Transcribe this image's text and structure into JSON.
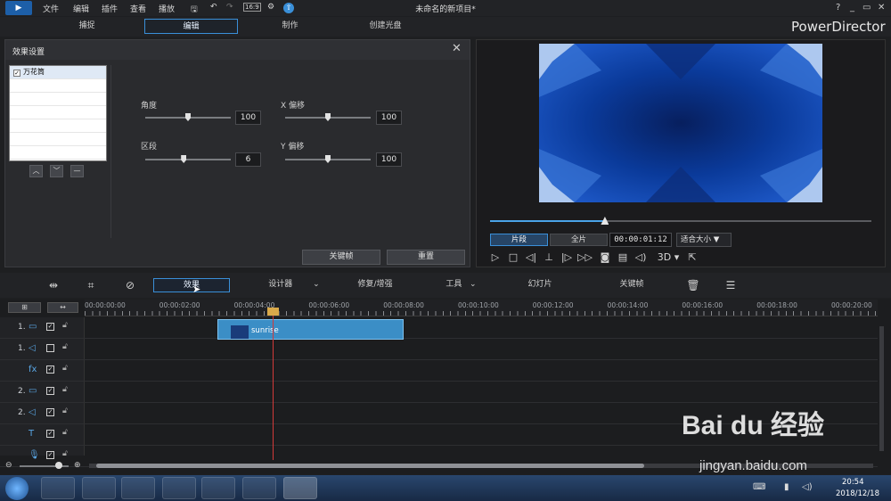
{
  "menu": {
    "items": [
      "文件",
      "编辑",
      "插件",
      "查看",
      "播放"
    ],
    "doc_title": "未命名的新项目*"
  },
  "window_controls": {
    "help": "?",
    "minimize": "_",
    "restore": "▭",
    "close": "✕"
  },
  "modes": [
    {
      "label": "捕捉"
    },
    {
      "label": "编辑",
      "active": true
    },
    {
      "label": "制作"
    },
    {
      "label": "创建光盘"
    }
  ],
  "brand": "PowerDirector",
  "effect_panel": {
    "title": "效果设置",
    "list": [
      {
        "label": "万花筒",
        "checked": true
      }
    ],
    "params": {
      "angle": {
        "label": "角度",
        "value": "100",
        "level": 0.5
      },
      "x_offset": {
        "label": "X 偏移",
        "value": "100",
        "level": 0.5
      },
      "segment": {
        "label": "区段",
        "value": "6",
        "level": 0.45
      },
      "y_offset": {
        "label": "Y 偏移",
        "value": "100",
        "level": 0.5
      }
    },
    "keyframe_button": "关键帧",
    "reset_button": "重置"
  },
  "preview": {
    "tab_clip": "片段",
    "tab_movie": "全片",
    "timecode": "00:00:01:12",
    "fit": "适合大小",
    "progress": 0.3,
    "stereo": "3D"
  },
  "toolbar": {
    "effect": "效果",
    "designer": "设计器",
    "fix_enhance": "修复/增强",
    "tools": "工具",
    "slideshow": "幻灯片",
    "keyframe": "关键帧"
  },
  "timeline": {
    "ruler": [
      "00:00:00:00",
      "00:00:02:00",
      "00:00:04:00",
      "00:00:06:00",
      "00:00:08:00",
      "00:00:10:00",
      "00:00:12:00",
      "00:00:14:00",
      "00:00:16:00",
      "00:00:18:00",
      "00:00:20:00"
    ],
    "tracks": [
      {
        "label": "1.",
        "icon": "video-track-icon",
        "glyph": "▭"
      },
      {
        "label": "1.",
        "icon": "audio-track-icon",
        "glyph": "◁"
      },
      {
        "label": "",
        "icon": "fx-track-icon",
        "glyph": "fx"
      },
      {
        "label": "2.",
        "icon": "video-track-icon",
        "glyph": "▭"
      },
      {
        "label": "2.",
        "icon": "audio-track-icon",
        "glyph": "◁"
      },
      {
        "label": "",
        "icon": "title-track-icon",
        "glyph": "T"
      },
      {
        "label": "",
        "icon": "voice-track-icon",
        "glyph": "🎙"
      }
    ],
    "clip_label": "sunrise"
  },
  "taskbar": {
    "time": "20:54",
    "date": "2018/12/18"
  },
  "watermark": {
    "brand": "Bai du 经验",
    "url": "jingyan.baidu.com"
  },
  "colors": {
    "accent": "#3a8fd8",
    "clip": "#3b8ec6",
    "playhead": "#d23a3a"
  }
}
